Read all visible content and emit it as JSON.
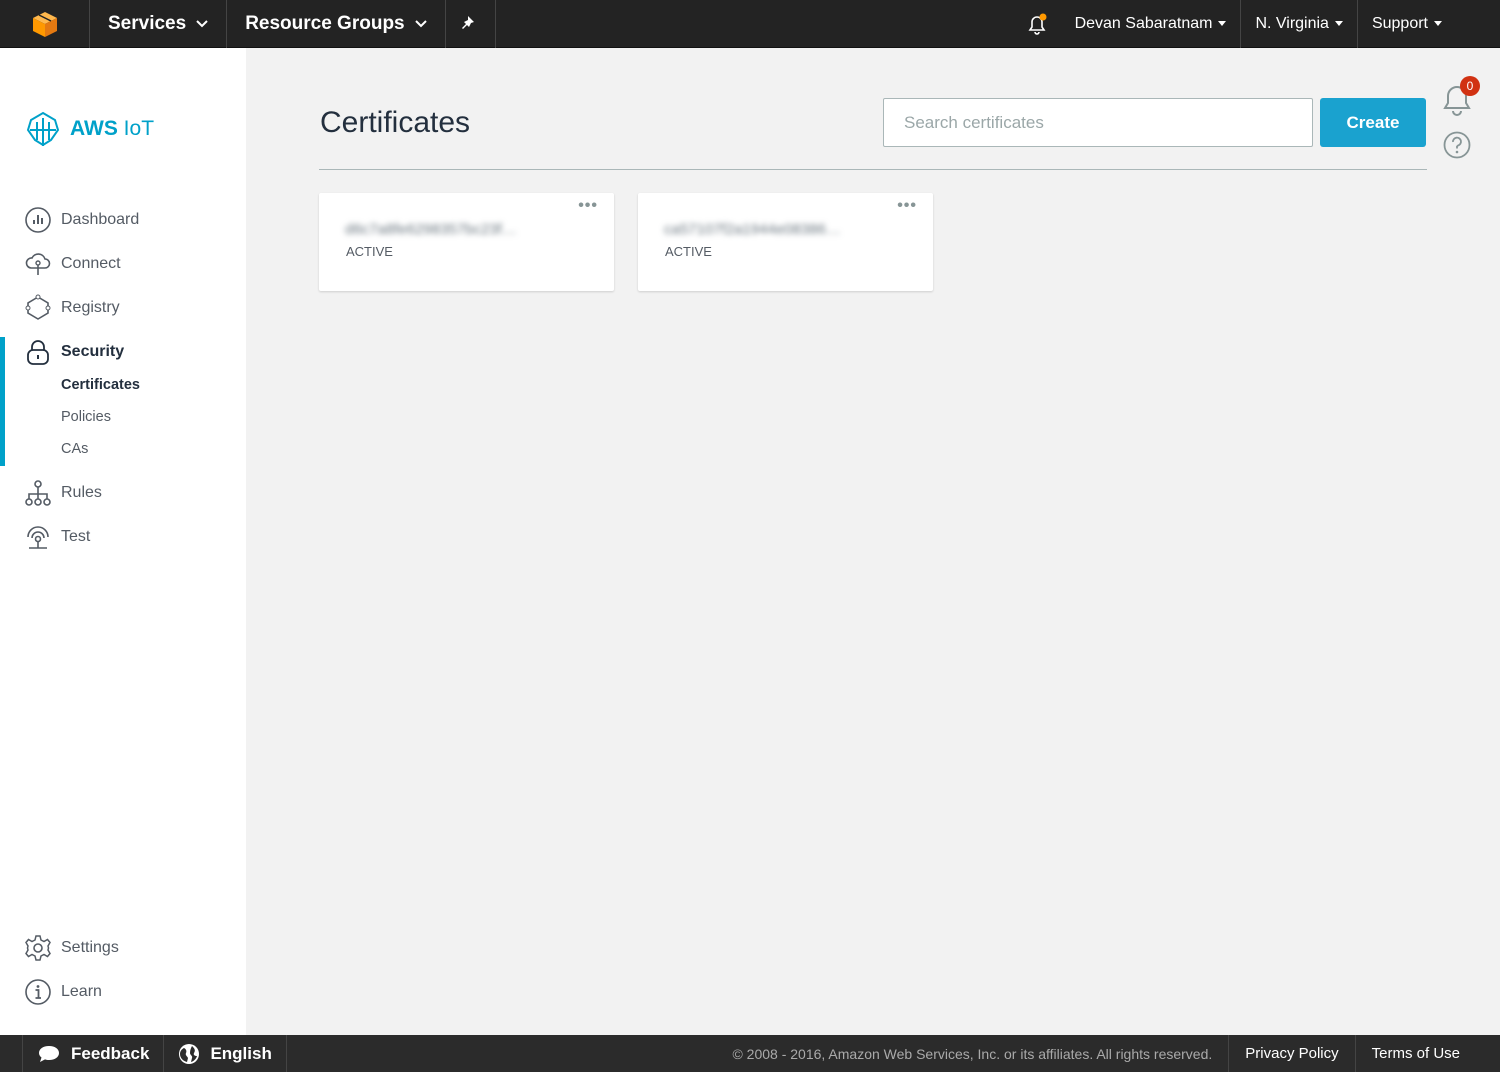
{
  "topbar": {
    "services_label": "Services",
    "resource_groups_label": "Resource Groups",
    "user_label": "Devan Sabaratnam",
    "region_label": "N. Virginia",
    "support_label": "Support"
  },
  "sidebar": {
    "brand_bold": "AWS",
    "brand_light": " IoT",
    "items": [
      {
        "label": "Dashboard",
        "icon": "dashboard-icon"
      },
      {
        "label": "Connect",
        "icon": "connect-icon"
      },
      {
        "label": "Registry",
        "icon": "registry-icon"
      },
      {
        "label": "Security",
        "icon": "lock-icon"
      },
      {
        "label": "Rules",
        "icon": "rules-icon"
      },
      {
        "label": "Test",
        "icon": "test-icon"
      }
    ],
    "security_sub": [
      "Certificates",
      "Policies",
      "CAs"
    ],
    "bottom_items": [
      {
        "label": "Settings",
        "icon": "gear-icon"
      },
      {
        "label": "Learn",
        "icon": "info-icon"
      }
    ]
  },
  "main": {
    "title": "Certificates",
    "search_placeholder": "Search certificates",
    "create_label": "Create",
    "notification_count": "0",
    "cards": [
      {
        "id": "d6c7a8fe6298357bc23f…",
        "status": "ACTIVE",
        "menu": "•••"
      },
      {
        "id": "ca57107f2a1944e08386…",
        "status": "ACTIVE",
        "menu": "•••"
      }
    ]
  },
  "footer": {
    "feedback_label": "Feedback",
    "language_label": "English",
    "copyright": "© 2008 - 2016, Amazon Web Services, Inc. or its affiliates. All rights reserved.",
    "privacy_label": "Privacy Policy",
    "terms_label": "Terms of Use"
  },
  "colors": {
    "accent": "#00a1c9",
    "create_button": "#1aa2cf",
    "topbar": "#232323",
    "badge": "#d13212",
    "aws_orange": "#ff9900"
  }
}
